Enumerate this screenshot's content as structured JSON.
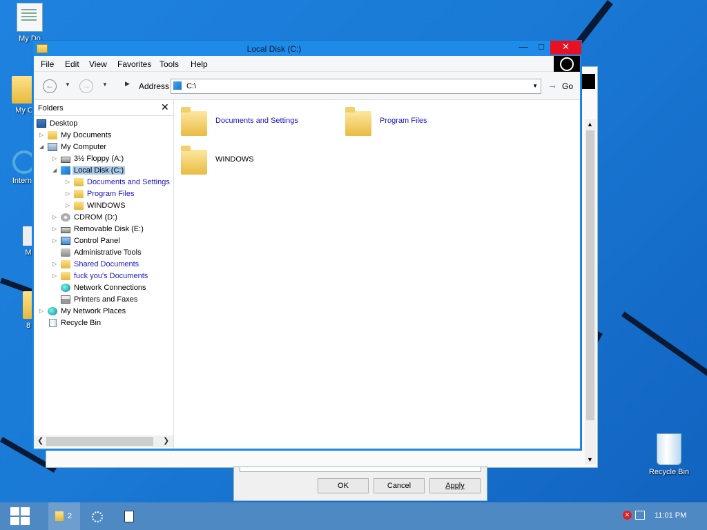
{
  "desktop": {
    "icons": [
      {
        "label": "My Do"
      },
      {
        "label": "My C"
      },
      {
        "label": "Interne"
      },
      {
        "label": "M"
      },
      {
        "label": "8"
      },
      {
        "label": "Recycle Bin"
      }
    ]
  },
  "background_dialog": {
    "ok": "OK",
    "cancel": "Cancel",
    "apply": "Apply"
  },
  "window": {
    "title": "Local Disk (C:)",
    "minimize": "—",
    "maximize": "□",
    "close": "✕",
    "menu": [
      "File",
      "Edit",
      "View",
      "Favorites",
      "Tools",
      "Help"
    ],
    "toolbar": {
      "address_label": "Address",
      "address_value": "C:\\",
      "go_label": "Go"
    },
    "folders_pane": {
      "title": "Folders",
      "close": "✕",
      "tree": [
        {
          "label": "Desktop"
        },
        {
          "label": "My Documents"
        },
        {
          "label": "My Computer"
        },
        {
          "label": "3½ Floppy (A:)"
        },
        {
          "label": "Local Disk (C:)"
        },
        {
          "label": "Documents and Settings"
        },
        {
          "label": "Program Files"
        },
        {
          "label": "WINDOWS"
        },
        {
          "label": "CDROM (D:)"
        },
        {
          "label": "Removable Disk (E:)"
        },
        {
          "label": "Control Panel"
        },
        {
          "label": "Administrative Tools"
        },
        {
          "label": "Shared Documents"
        },
        {
          "label": "fuck you's Documents"
        },
        {
          "label": "Network Connections"
        },
        {
          "label": "Printers and Faxes"
        },
        {
          "label": "My Network Places"
        },
        {
          "label": "Recycle Bin"
        }
      ]
    },
    "content_items": [
      {
        "label": "Documents and Settings"
      },
      {
        "label": "Program Files"
      },
      {
        "label": "WINDOWS"
      }
    ]
  },
  "taskbar": {
    "group_count": "2",
    "clock": "11:01 PM"
  }
}
